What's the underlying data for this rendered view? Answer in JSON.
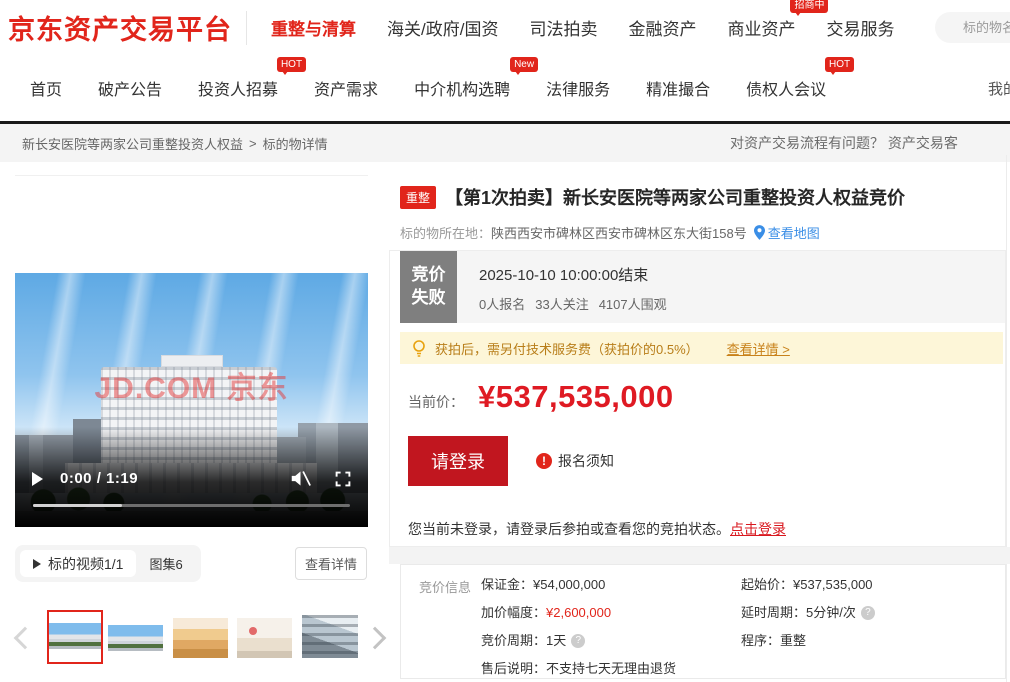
{
  "header": {
    "logo": "京东资产交易平台",
    "nav": [
      {
        "label": "重整与清算"
      },
      {
        "label": "海关/政府/国资"
      },
      {
        "label": "司法拍卖"
      },
      {
        "label": "金融资产"
      },
      {
        "label": "商业资产"
      },
      {
        "label": "交易服务",
        "badge": "招商中"
      }
    ],
    "search_placeholder": "标的物名称"
  },
  "subnav": {
    "items": [
      {
        "label": "首页"
      },
      {
        "label": "破产公告"
      },
      {
        "label": "投资人招募",
        "badge": "HOT"
      },
      {
        "label": "资产需求"
      },
      {
        "label": "中介机构选聘",
        "badge": "New"
      },
      {
        "label": "法律服务"
      },
      {
        "label": "精准撮合"
      },
      {
        "label": "债权人会议",
        "badge": "HOT"
      }
    ],
    "right_label": "我的"
  },
  "breadcrumb": {
    "parent": "新长安医院等两家公司重整投资人权益",
    "separator": ">",
    "current": "标的物详情",
    "help_text": "对资产交易流程有问题？ 资产交易客"
  },
  "media": {
    "video": {
      "time": "0:00 / 1:19",
      "watermark": "JD.COM 京东"
    },
    "tabs": {
      "video_tab": "标的视频1/1",
      "gallery_tab": "图集6"
    },
    "detail_button": "查看详情"
  },
  "listing": {
    "tag": "重整",
    "title": "【第1次拍卖】新长安医院等两家公司重整投资人权益竞价",
    "location_label": "标的物所在地：",
    "location": "陕西西安市碑林区西安市碑林区东大街158号",
    "map_link": "查看地图"
  },
  "bid_panel": {
    "status_line1": "竞价",
    "status_line2": "失败",
    "end_time": "2025-10-10 10:00:00结束",
    "stats": [
      "0人报名",
      "33人关注",
      "4107人围观"
    ],
    "notice_text": "获拍后，需另付技术服务费（获拍价的0.5%）",
    "notice_link": "查看详情 >",
    "price_label": "当前价：",
    "price_value": "¥537,535,000",
    "login_button": "请登录",
    "signup_notice": "报名须知",
    "login_hint": "您当前未登录，请登录后参拍或查看您的竞拍状态。",
    "login_link": "点击登录"
  },
  "bid_info": {
    "section_label": "竞价信息",
    "left": [
      {
        "label": "保证金：",
        "value": "¥54,000,000"
      },
      {
        "label": "加价幅度：",
        "value": "¥2,600,000"
      },
      {
        "label": "竞价周期：",
        "value": "1天"
      },
      {
        "label": "售后说明：",
        "value": "不支持七天无理由退货"
      }
    ],
    "right": [
      {
        "label": "起始价：",
        "value": "¥537,535,000"
      },
      {
        "label": "延时周期：",
        "value": "5分钟/次"
      },
      {
        "label": "程序：",
        "value": "重整"
      }
    ]
  },
  "icons": {
    "exclamation": "!",
    "question": "?"
  },
  "colors": {
    "brand_red": "#e1251b",
    "button_red": "#c1161f",
    "price_red": "#df1a23",
    "status_gray": "#7f7f7f",
    "notice_bg": "#fdf6d8",
    "link_blue": "#3a8ee6"
  }
}
